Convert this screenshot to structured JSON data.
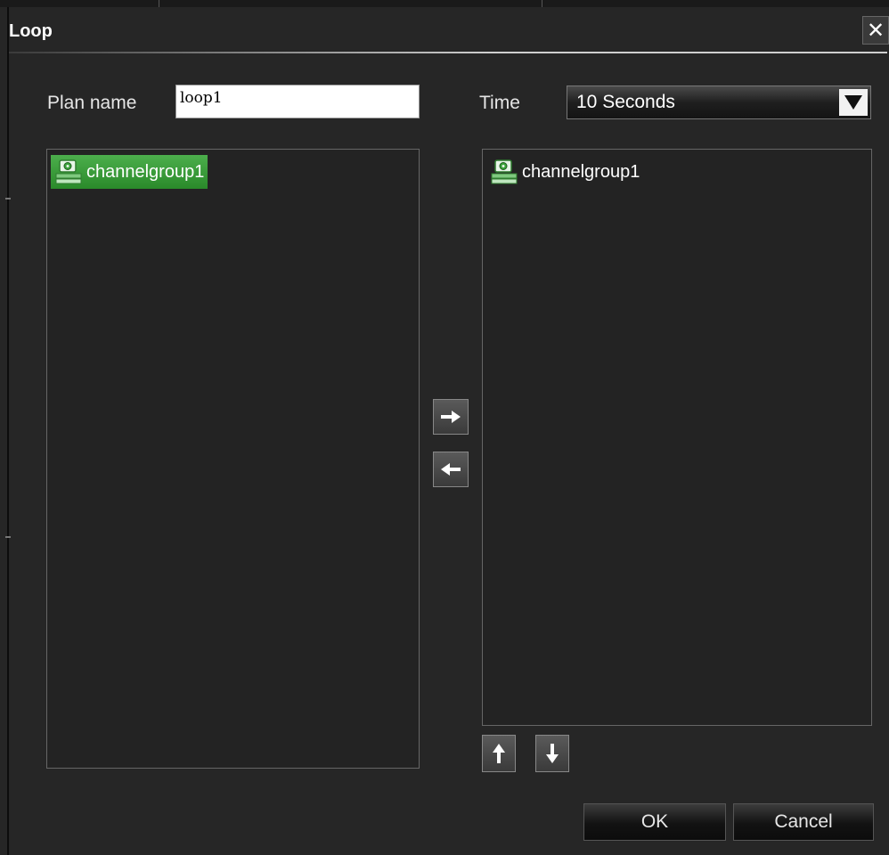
{
  "dialog": {
    "title": "Loop",
    "close_icon": "close-icon",
    "close_label": "✕"
  },
  "form": {
    "plan_name_label": "Plan name",
    "plan_name_value": "loop1",
    "time_label": "Time",
    "time_value": "10 Seconds",
    "time_dropdown_icon": "triangle-down-icon"
  },
  "available_list": {
    "items": [
      {
        "label": "channelgroup1",
        "icon": "channel-group-icon",
        "selected": true
      }
    ]
  },
  "selected_list": {
    "items": [
      {
        "label": "channelgroup1",
        "icon": "channel-group-icon",
        "selected": false
      }
    ]
  },
  "transfer": {
    "add_icon": "arrow-right-icon",
    "remove_icon": "arrow-left-icon"
  },
  "order": {
    "move_up_icon": "arrow-up-icon",
    "move_down_icon": "arrow-down-icon"
  },
  "footer": {
    "ok_label": "OK",
    "cancel_label": "Cancel"
  },
  "colors": {
    "background": "#262626",
    "selection_green": "#3a9e3a",
    "text": "#ffffff"
  }
}
